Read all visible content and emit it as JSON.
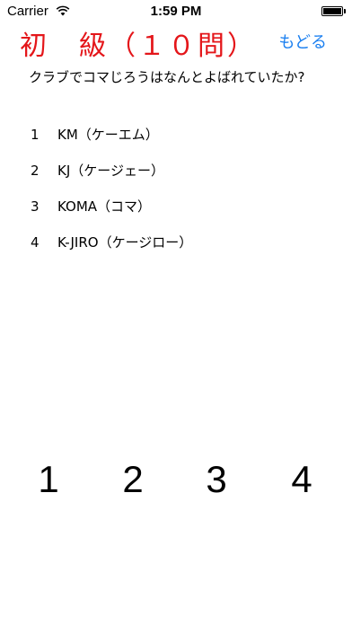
{
  "status_bar": {
    "carrier": "Carrier",
    "time": "1:59 PM",
    "battery_level": 1.0
  },
  "header": {
    "title": "初　級（１０問）",
    "back_label": "もどる"
  },
  "question": {
    "text": "クラブでコマじろうはなんとよばれていたか?"
  },
  "options": [
    {
      "num": "1",
      "text": "KM（ケーエム）"
    },
    {
      "num": "2",
      "text": "KJ（ケージェー）"
    },
    {
      "num": "3",
      "text": "KOMA（コマ）"
    },
    {
      "num": "4",
      "text": "K-JIRO（ケージロー）"
    }
  ],
  "answer_buttons": [
    "1",
    "2",
    "3",
    "4"
  ],
  "colors": {
    "title": "#e4161a",
    "link": "#1a7ff0"
  }
}
